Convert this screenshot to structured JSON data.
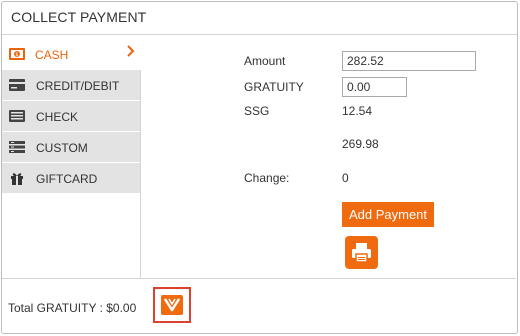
{
  "dialog": {
    "title": "COLLECT PAYMENT"
  },
  "sidebar": {
    "items": [
      {
        "label": "CASH",
        "icon": "cash-icon",
        "active": true
      },
      {
        "label": "CREDIT/DEBIT",
        "icon": "credit-card-icon",
        "active": false
      },
      {
        "label": "CHECK",
        "icon": "check-icon",
        "active": false
      },
      {
        "label": "CUSTOM",
        "icon": "custom-icon",
        "active": false
      },
      {
        "label": "GIFTCARD",
        "icon": "gift-icon",
        "active": false
      }
    ]
  },
  "payment": {
    "amount_label": "Amount",
    "amount_value": "282.52",
    "gratuity_label": "GRATUITY",
    "gratuity_value": "0.00",
    "ssg_label": "SSG",
    "ssg_value": "12.54",
    "subtotal_value": "269.98",
    "change_label": "Change:",
    "change_value": "0",
    "add_payment_label": "Add Payment",
    "print_icon": "printer-icon"
  },
  "footer": {
    "total_gratuity_text": "Total GRATUITY : $0.00",
    "gratuity_icon": "gratuity-icon"
  },
  "colors": {
    "accent": "#f06a0f",
    "active_text": "#e8650e",
    "highlight_border": "#d9422f",
    "sidebar_bg": "#e3e3e3"
  }
}
